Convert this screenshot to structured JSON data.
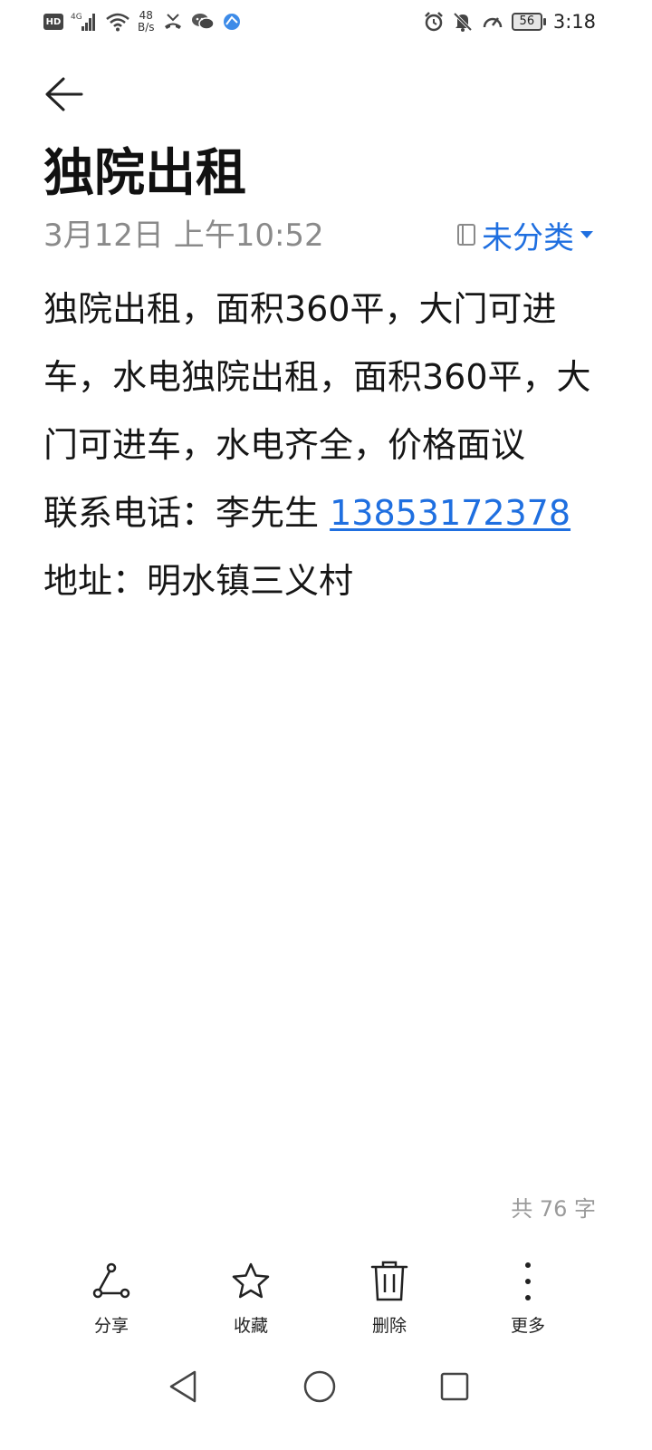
{
  "status_bar": {
    "hd": "HD",
    "network_type": "4G",
    "net_speed_value": "48",
    "net_speed_unit": "B/s",
    "battery": "56",
    "time": "3:18",
    "icons": [
      "hd-icon",
      "signal-icon",
      "wifi-icon",
      "missed-call-icon",
      "wechat-icon",
      "browser-icon",
      "alarm-icon",
      "mute-icon",
      "speedometer-icon",
      "battery-icon"
    ]
  },
  "header": {
    "title": "独院出租",
    "date": "3月12日 上午10:52",
    "category": "未分类"
  },
  "note": {
    "paragraph": "独院出租，面积360平，大门可进车，水电独院出租，面积360平，大门可进车，水电齐全，价格面议",
    "contact_label": "联系电话：李先生 ",
    "phone": "13853172378",
    "address": "地址：明水镇三义村"
  },
  "word_count": "共 76 字",
  "toolbar": {
    "share": "分享",
    "favorite": "收藏",
    "delete": "删除",
    "more": "更多"
  },
  "colors": {
    "accent": "#1f6fe0",
    "text": "#161616",
    "muted": "#8a8a8a"
  }
}
